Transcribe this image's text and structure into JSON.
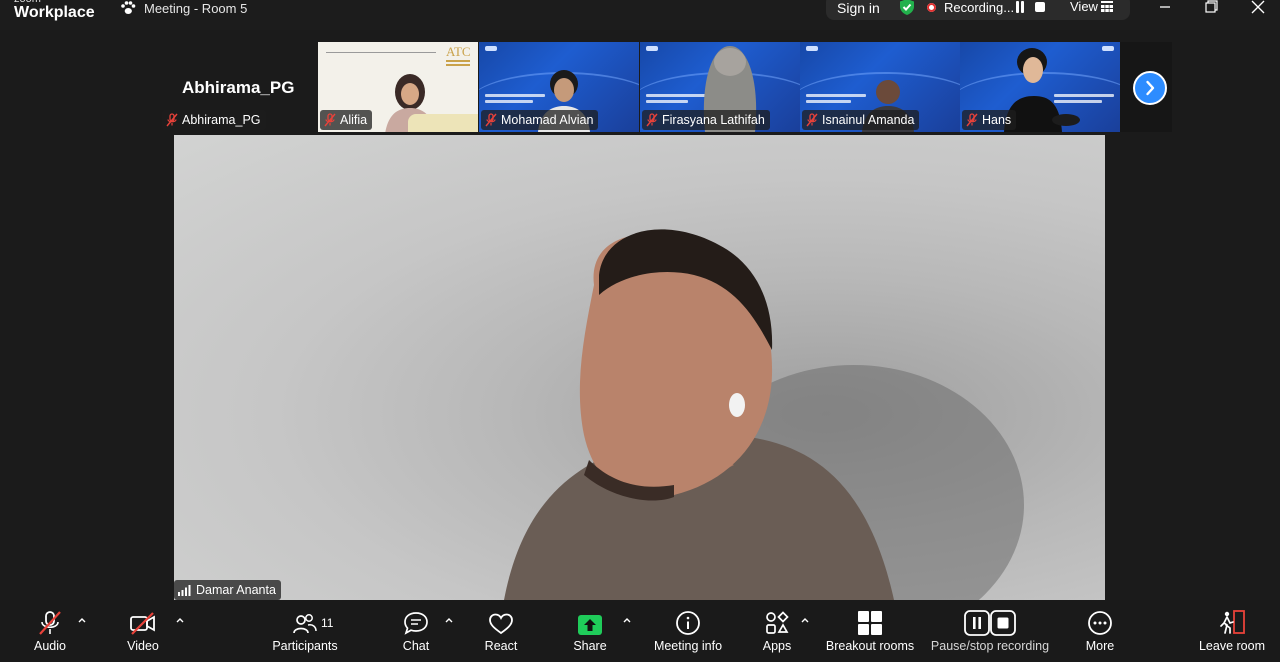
{
  "app": {
    "brand_small": "zoom",
    "brand_big": "Workplace"
  },
  "meeting": {
    "title": "Meeting - Room 5"
  },
  "titlebar": {
    "sign_in": "Sign in",
    "recording_label": "Recording...",
    "view_label": "View"
  },
  "gallery": {
    "active_name": "Abhirama_PG",
    "active_tag": "Abhirama_PG",
    "participants": [
      {
        "name": "Alifia",
        "muted": true
      },
      {
        "name": "Mohamad Alvian",
        "muted": true
      },
      {
        "name": "Firasyana Lathifah",
        "muted": true
      },
      {
        "name": "Isnainul Amanda",
        "muted": true
      },
      {
        "name": "Hans",
        "muted": true
      }
    ],
    "slide_logo_text": "ATC"
  },
  "main_speaker": {
    "name": "Damar Ananta"
  },
  "toolbar": {
    "audio": "Audio",
    "video": "Video",
    "participants": "Participants",
    "participants_count": "11",
    "chat": "Chat",
    "react": "React",
    "share": "Share",
    "meeting_info": "Meeting info",
    "apps": "Apps",
    "breakout_rooms": "Breakout rooms",
    "pause_stop_recording": "Pause/stop recording",
    "more": "More",
    "leave_room": "Leave room"
  },
  "colors": {
    "accent": "#2d8cff",
    "share_green": "#1fcc5a",
    "mute_red": "#e8423a",
    "recording_red": "#e02f2f"
  }
}
